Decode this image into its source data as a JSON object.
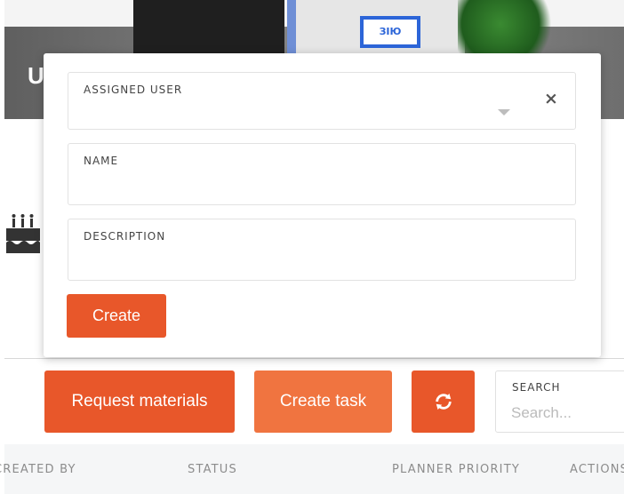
{
  "hero": {
    "title_initial": "U",
    "sign_text": "ЗІЮ"
  },
  "modal": {
    "assigned_user": {
      "label": "ASSIGNED USER",
      "value": "",
      "clear_symbol": "×"
    },
    "name": {
      "label": "NAME",
      "value": ""
    },
    "description": {
      "label": "DESCRIPTION",
      "value": ""
    },
    "create_label": "Create"
  },
  "toolbar": {
    "request_materials_label": "Request materials",
    "create_task_label": "Create task",
    "refresh_icon": "refresh-icon",
    "search": {
      "label": "SEARCH",
      "placeholder": "Search..."
    }
  },
  "table": {
    "columns": [
      "CREATED BY",
      "STATUS",
      "PLANNER PRIORITY",
      "ACTIONS"
    ]
  },
  "colors": {
    "primary": "#e8572a",
    "secondary": "#f07440",
    "table_header_bg": "#f5f6f7"
  }
}
